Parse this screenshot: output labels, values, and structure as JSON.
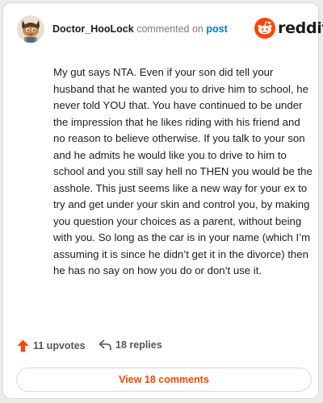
{
  "header": {
    "username": "Doctor_HooLock",
    "action_text": "commented on",
    "post_link_label": "post",
    "avatar_icon": "user-avatar-icon",
    "logo_icon": "reddit-snoo-icon",
    "logo_text": "reddit"
  },
  "comment": {
    "body": "My gut says NTA. Even if your son did tell your husband that he wanted you to drive him to school, he never told YOU that. You have continued to be under the impression that he likes riding with his friend and no reason to believe otherwise. If you talk to your son and he admits he would like you to drive to him to school and you still say hell no THEN you would be the asshole. This just seems like a new way for your ex to try and get under your skin and control you, by making you question your choices as a parent, without being with you. So long as the car is in your name (which I’m assuming it is since he didn’t get it in the divorce) then he has no say on how you do or don’t use it."
  },
  "actions": {
    "upvotes_label": "11 upvotes",
    "replies_label": "18 replies",
    "upvote_icon": "upvote-arrow-icon",
    "reply_icon": "reply-arrow-icon"
  },
  "footer": {
    "view_comments_label": "View 18 comments"
  },
  "colors": {
    "brand": "#ff4500",
    "link": "#0079d3",
    "text": "#1c1c1c",
    "muted": "#7c7c7c"
  }
}
